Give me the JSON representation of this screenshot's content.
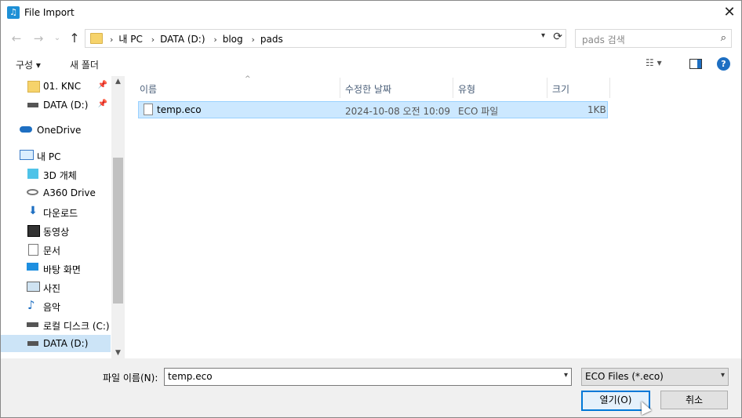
{
  "window": {
    "title": "File Import",
    "close_glyph": "✕"
  },
  "nav": {
    "back": "←",
    "forward": "→",
    "history": "⌄",
    "up": "↑"
  },
  "address": {
    "crumbs": [
      "내 PC",
      "DATA (D:)",
      "blog",
      "pads"
    ],
    "separator": "›"
  },
  "search": {
    "placeholder": "pads 검색"
  },
  "toolbar": {
    "organize": "구성 ▾",
    "new_folder": "새 폴더"
  },
  "sidebar": {
    "items": [
      {
        "label": "01. KNC",
        "icon": "folder-icon",
        "pinned": true
      },
      {
        "label": "DATA (D:)",
        "icon": "drive-icon",
        "pinned": true
      },
      {
        "label": "OneDrive",
        "icon": "cloud-icon"
      },
      {
        "label": "내 PC",
        "icon": "computer-icon"
      },
      {
        "label": "3D 개체",
        "icon": "cube-icon"
      },
      {
        "label": "A360 Drive",
        "icon": "a360-drive-icon"
      },
      {
        "label": "다운로드",
        "icon": "download-icon"
      },
      {
        "label": "동영상",
        "icon": "video-icon"
      },
      {
        "label": "문서",
        "icon": "document-icon"
      },
      {
        "label": "바탕 화면",
        "icon": "desktop-icon"
      },
      {
        "label": "사진",
        "icon": "pictures-icon"
      },
      {
        "label": "음악",
        "icon": "music-icon"
      },
      {
        "label": "로컬 디스크 (C:)",
        "icon": "local-disk-icon"
      },
      {
        "label": "DATA (D:)",
        "icon": "drive-icon",
        "selected": true
      }
    ]
  },
  "columns": [
    "이름",
    "수정한 날짜",
    "유형",
    "크기"
  ],
  "files": [
    {
      "name": "temp.eco",
      "modified": "2024-10-08 오전 10:09",
      "type": "ECO 파일",
      "size": "1KB"
    }
  ],
  "footer": {
    "filename_label": "파일 이름(N):",
    "filename_value": "temp.eco",
    "filetype_value": "ECO Files (*.eco)",
    "open_label": "열기(O)",
    "cancel_label": "취소"
  },
  "colors": {
    "accent": "#0078d7",
    "selection": "#cce8ff",
    "folder": "#f6d36b"
  }
}
